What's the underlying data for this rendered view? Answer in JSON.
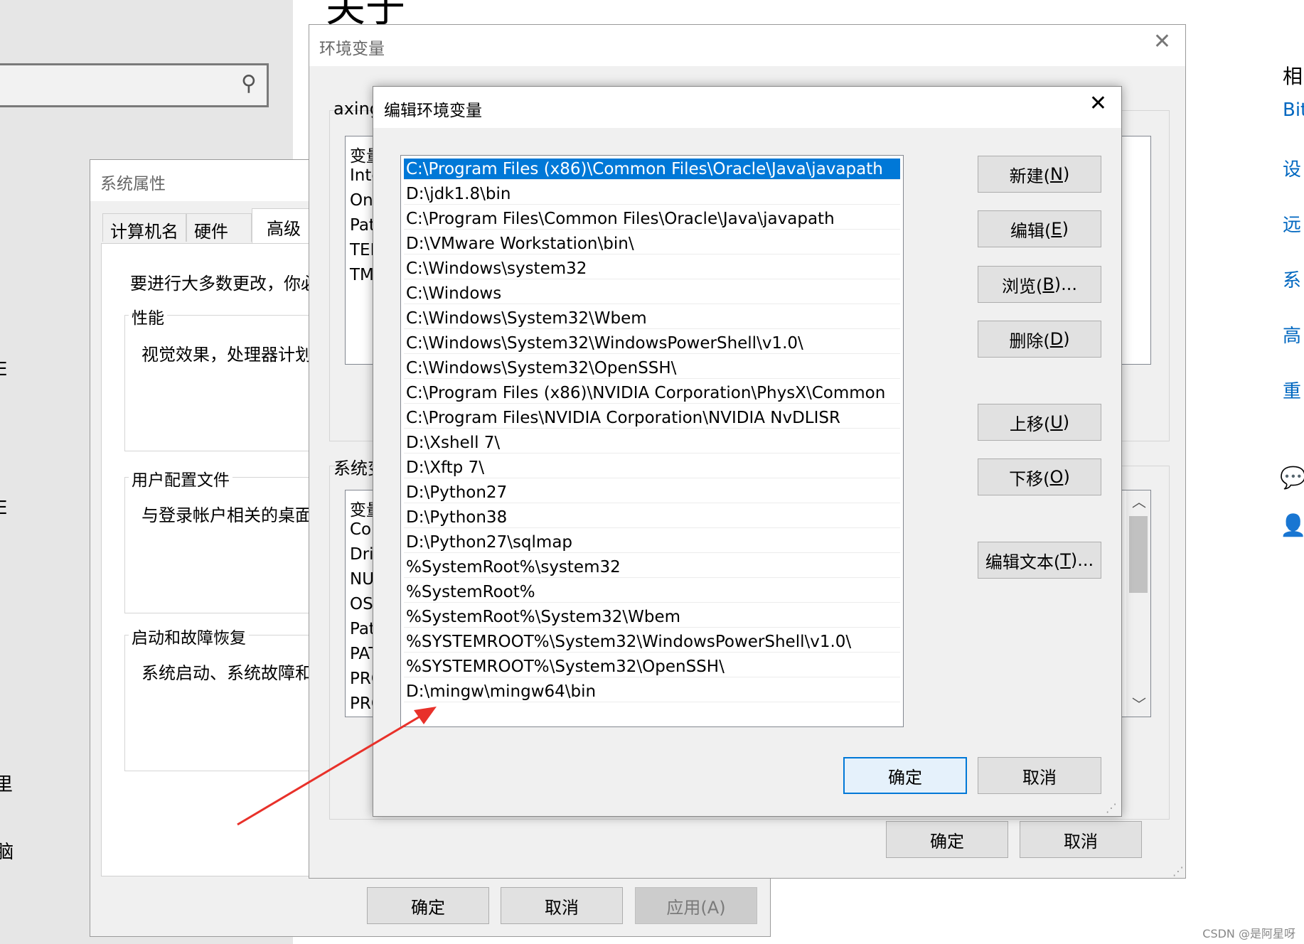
{
  "background_settings": {
    "heading_fragment": "关于",
    "right_panel": {
      "heading": "相",
      "links": [
        "Bit",
        "设",
        "远",
        "系",
        "高",
        "重"
      ]
    },
    "left_edge_fragments": [
      "E",
      "E",
      "里",
      "l脑"
    ]
  },
  "system_properties": {
    "title": "系统属性",
    "tabs": [
      "计算机名",
      "硬件",
      "高级"
    ],
    "active_tab": "高级",
    "intro_text": "要进行大多数更改，你必",
    "groups": [
      {
        "label": "性能",
        "text": "视觉效果，处理器计划"
      },
      {
        "label": "用户配置文件",
        "text": "与登录帐户相关的桌面"
      },
      {
        "label": "启动和故障恢复",
        "text": "系统启动、系统故障和"
      }
    ],
    "buttons": {
      "ok": "确定",
      "cancel": "取消",
      "apply": "应用(A)"
    }
  },
  "env_vars": {
    "title": "环境变量",
    "user_section_label": "axing",
    "user_vars_header": "变量",
    "user_vars": [
      "Inte",
      "On",
      "Pat",
      "TEM",
      "TM"
    ],
    "system_section_label": "系统变",
    "system_vars_header": "变量",
    "system_vars": [
      "Co",
      "Dri",
      "NU",
      "OS",
      "Pat",
      "PAT",
      "PRO",
      "PRO"
    ],
    "buttons": {
      "ok": "确定",
      "cancel": "取消"
    }
  },
  "edit_env": {
    "title": "编辑环境变量",
    "selected_index": 0,
    "paths": [
      "C:\\Program Files (x86)\\Common Files\\Oracle\\Java\\javapath",
      "D:\\jdk1.8\\bin",
      "C:\\Program Files\\Common Files\\Oracle\\Java\\javapath",
      "D:\\VMware Workstation\\bin\\",
      "C:\\Windows\\system32",
      "C:\\Windows",
      "C:\\Windows\\System32\\Wbem",
      "C:\\Windows\\System32\\WindowsPowerShell\\v1.0\\",
      "C:\\Windows\\System32\\OpenSSH\\",
      "C:\\Program Files (x86)\\NVIDIA Corporation\\PhysX\\Common",
      "C:\\Program Files\\NVIDIA Corporation\\NVIDIA NvDLISR",
      "D:\\Xshell 7\\",
      "D:\\Xftp 7\\",
      "D:\\Python27",
      "D:\\Python38",
      "D:\\Python27\\sqlmap",
      "%SystemRoot%\\system32",
      "%SystemRoot%",
      "%SystemRoot%\\System32\\Wbem",
      "%SYSTEMROOT%\\System32\\WindowsPowerShell\\v1.0\\",
      "%SYSTEMROOT%\\System32\\OpenSSH\\",
      "D:\\mingw\\mingw64\\bin"
    ],
    "buttons": {
      "new": {
        "text": "新建(",
        "key": "N",
        "end": ")"
      },
      "edit": {
        "text": "编辑(",
        "key": "E",
        "end": ")"
      },
      "browse": {
        "text": "浏览(",
        "key": "B",
        "end": ")..."
      },
      "delete": {
        "text": "删除(",
        "key": "D",
        "end": ")"
      },
      "move_up": {
        "text": "上移(",
        "key": "U",
        "end": ")"
      },
      "move_down": {
        "text": "下移(",
        "key": "O",
        "end": ")"
      },
      "edit_text": {
        "text": "编辑文本(",
        "key": "T",
        "end": ")..."
      },
      "ok": "确定",
      "cancel": "取消"
    }
  },
  "annotation": {
    "arrow_color": "#e8312a"
  },
  "watermark": "CSDN @是阿星呀",
  "colors": {
    "selection": "#0078d7",
    "link": "#0067c0",
    "dialog_bg": "#f0f0f0"
  }
}
